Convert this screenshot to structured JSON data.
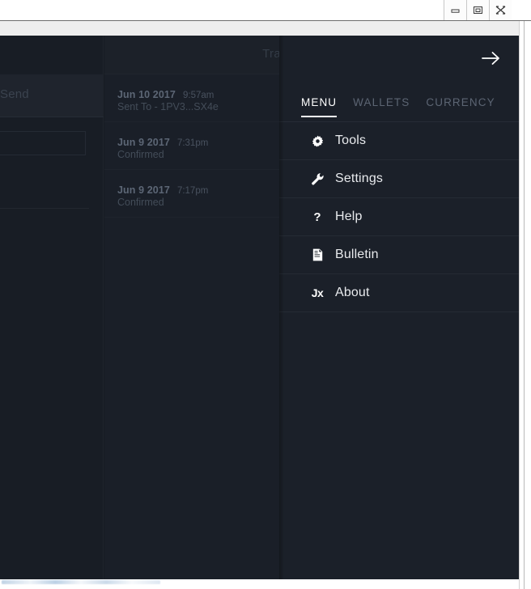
{
  "window": {
    "controls": [
      {
        "name": "minimize",
        "label": "Minimize"
      },
      {
        "name": "restore",
        "label": "Restore"
      },
      {
        "name": "close",
        "label": "Close"
      }
    ]
  },
  "background_app": {
    "send_panel": {
      "label": "Send",
      "address_input_value": "",
      "address_input_placeholder": ""
    },
    "transactions": {
      "header_title": "Tra",
      "rows": [
        {
          "date": "Jun 10 2017",
          "time": "9:57am",
          "status": "Sent To - 1PV3...SX4e"
        },
        {
          "date": "Jun 9 2017",
          "time": "7:31pm",
          "status": "Confirmed"
        },
        {
          "date": "Jun 9 2017",
          "time": "7:17pm",
          "status": "Confirmed"
        }
      ]
    }
  },
  "drawer": {
    "close_icon": "arrow-right-icon",
    "tabs": [
      {
        "label": "MENU",
        "active": true
      },
      {
        "label": "WALLETS",
        "active": false
      },
      {
        "label": "CURRENCY",
        "active": false
      }
    ],
    "menu_items": [
      {
        "label": "Tools",
        "icon": "gear-icon"
      },
      {
        "label": "Settings",
        "icon": "wrench-icon"
      },
      {
        "label": "Help",
        "icon": "question-mark-icon"
      },
      {
        "label": "Bulletin",
        "icon": "document-icon"
      },
      {
        "label": "About",
        "icon": "jaxx-logo-icon"
      }
    ]
  },
  "colors": {
    "drawer_bg": "#1b2029",
    "app_bg": "#171c23",
    "panel_bg": "#1a1f28",
    "active_tab": "#ffffff",
    "inactive_tab": "#5c6573",
    "menu_label": "#e8eaed",
    "divider": "#252b34"
  }
}
